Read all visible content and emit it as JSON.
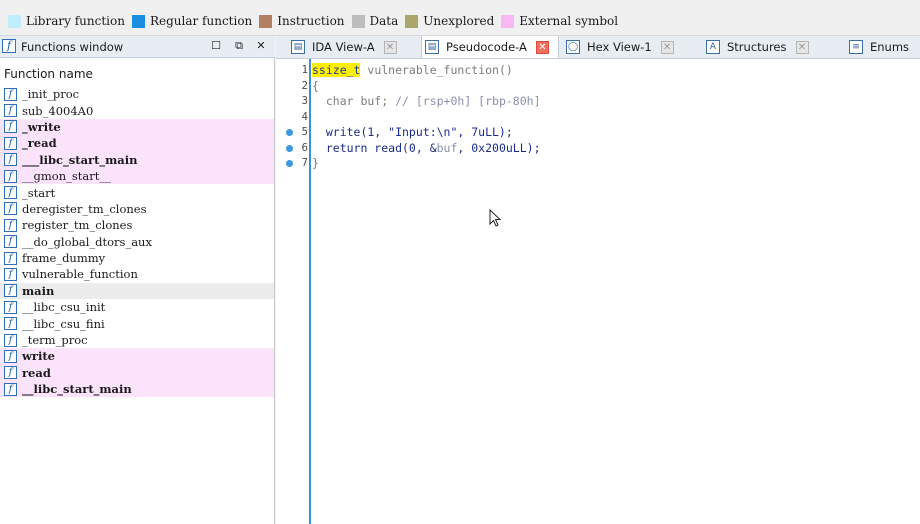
{
  "legend": [
    {
      "label": "Library function",
      "color": "#bfeffa"
    },
    {
      "label": "Regular function",
      "color": "#1a8fe0"
    },
    {
      "label": "Instruction",
      "color": "#b27f63"
    },
    {
      "label": "Data",
      "color": "#bdbdbd"
    },
    {
      "label": "Unexplored",
      "color": "#a9a76a"
    },
    {
      "label": "External symbol",
      "color": "#f8b8f2"
    }
  ],
  "functions_window": {
    "title": "Functions window",
    "column_header": "Function name",
    "icon_glyph": "f",
    "controls": {
      "maximize": "☐",
      "float": "⧉",
      "close": "✕"
    },
    "functions": [
      {
        "name": "_init_proc",
        "external": false,
        "bold": false,
        "selected": false
      },
      {
        "name": "sub_4004A0",
        "external": false,
        "bold": false,
        "selected": false
      },
      {
        "name": "_write",
        "external": true,
        "bold": true,
        "selected": false
      },
      {
        "name": "_read",
        "external": true,
        "bold": true,
        "selected": false
      },
      {
        "name": "___libc_start_main",
        "external": true,
        "bold": true,
        "selected": false
      },
      {
        "name": "__gmon_start__",
        "external": true,
        "bold": false,
        "selected": false
      },
      {
        "name": "_start",
        "external": false,
        "bold": false,
        "selected": false
      },
      {
        "name": "deregister_tm_clones",
        "external": false,
        "bold": false,
        "selected": false
      },
      {
        "name": "register_tm_clones",
        "external": false,
        "bold": false,
        "selected": false
      },
      {
        "name": "__do_global_dtors_aux",
        "external": false,
        "bold": false,
        "selected": false
      },
      {
        "name": "frame_dummy",
        "external": false,
        "bold": false,
        "selected": false
      },
      {
        "name": "vulnerable_function",
        "external": false,
        "bold": false,
        "selected": false
      },
      {
        "name": "main",
        "external": false,
        "bold": true,
        "selected": true
      },
      {
        "name": "__libc_csu_init",
        "external": false,
        "bold": false,
        "selected": false
      },
      {
        "name": "__libc_csu_fini",
        "external": false,
        "bold": false,
        "selected": false
      },
      {
        "name": "_term_proc",
        "external": false,
        "bold": false,
        "selected": false
      },
      {
        "name": "write",
        "external": true,
        "bold": true,
        "selected": false
      },
      {
        "name": "read",
        "external": true,
        "bold": true,
        "selected": false
      },
      {
        "name": "__libc_start_main",
        "external": true,
        "bold": true,
        "selected": false
      }
    ]
  },
  "tabs": [
    {
      "label": "IDA View-A",
      "icon": "▤",
      "active": false,
      "closable": true
    },
    {
      "label": "Pseudocode-A",
      "icon": "▤",
      "active": true,
      "closable": true
    },
    {
      "label": "Hex View-1",
      "icon": "◯",
      "active": false,
      "closable": true
    },
    {
      "label": "Structures",
      "icon": "A",
      "active": false,
      "closable": true
    },
    {
      "label": "Enums",
      "icon": "≡",
      "active": false,
      "closable": false
    }
  ],
  "pseudocode": {
    "lines": [
      {
        "num": "1",
        "breakpoint": false,
        "tokens": [
          {
            "t": "ssize_t",
            "c": "kw-hl"
          },
          {
            "t": " vulnerable_function()",
            "c": "c-dim"
          }
        ]
      },
      {
        "num": "2",
        "breakpoint": false,
        "tokens": [
          {
            "t": "{",
            "c": "c-dim"
          }
        ]
      },
      {
        "num": "3",
        "breakpoint": false,
        "tokens": [
          {
            "t": "  char buf; ",
            "c": "c-dim"
          },
          {
            "t": "// [rsp+0h] [rbp-80h]",
            "c": "c-cmt"
          }
        ]
      },
      {
        "num": "4",
        "breakpoint": false,
        "tokens": []
      },
      {
        "num": "5",
        "breakpoint": true,
        "tokens": [
          {
            "t": "  write(1, \"Input:\\n\", 7uLL);",
            "c": "c-ident"
          }
        ]
      },
      {
        "num": "6",
        "breakpoint": true,
        "tokens": [
          {
            "t": "  return read(0, &",
            "c": "c-ident"
          },
          {
            "t": "buf",
            "c": "c-cmt"
          },
          {
            "t": ", 0x200uLL);",
            "c": "c-ident"
          }
        ]
      },
      {
        "num": "7",
        "breakpoint": true,
        "tokens": [
          {
            "t": "}",
            "c": "c-dim"
          }
        ]
      }
    ]
  }
}
